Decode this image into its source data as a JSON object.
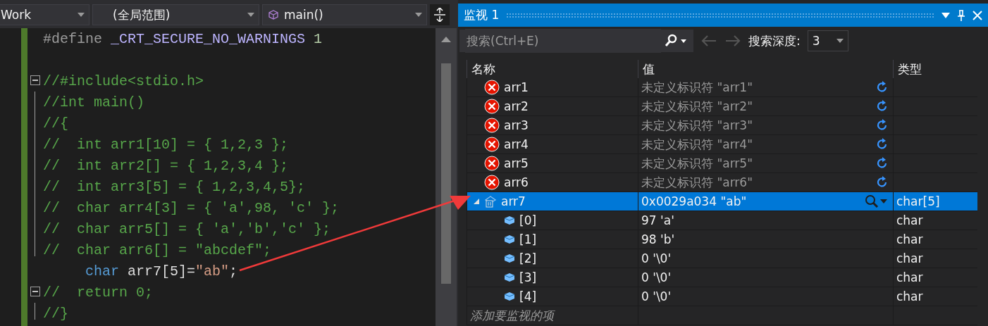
{
  "editor": {
    "dropdowns": [
      {
        "value": "Work",
        "kind": "plain"
      },
      {
        "value": "(全局范围)",
        "kind": "plain"
      },
      {
        "value": "main()",
        "kind": "function"
      }
    ],
    "lines": [
      {
        "fold": false,
        "tokens": [
          {
            "kind": "directive",
            "text": "#define "
          },
          {
            "kind": "macro",
            "text": "_CRT_SECURE_NO_WARNINGS "
          },
          {
            "kind": "number",
            "text": "1"
          }
        ]
      },
      {
        "fold": false
      },
      {
        "fold": true,
        "tokens": [
          {
            "kind": "comment",
            "text": "//#include<stdio.h>"
          }
        ]
      },
      {
        "fold": false,
        "tokens": [
          {
            "kind": "comment",
            "text": "//int main()"
          }
        ]
      },
      {
        "fold": false,
        "tokens": [
          {
            "kind": "comment",
            "text": "//{"
          }
        ]
      },
      {
        "fold": false,
        "tokens": [
          {
            "kind": "comment",
            "text": "//  int arr1[10] = { 1,2,3 };"
          }
        ]
      },
      {
        "fold": false,
        "tokens": [
          {
            "kind": "comment",
            "text": "//  int arr2[] = { 1,2,3,4 };"
          }
        ]
      },
      {
        "fold": false,
        "tokens": [
          {
            "kind": "comment",
            "text": "//  int arr3[5] = { 1,2,3,4,5};"
          }
        ]
      },
      {
        "fold": false,
        "tokens": [
          {
            "kind": "comment",
            "text": "//  char arr4[3] = { 'a',98, 'c' };"
          }
        ]
      },
      {
        "fold": false,
        "tokens": [
          {
            "kind": "comment",
            "text": "//  char arr5[] = { 'a','b','c' };"
          }
        ]
      },
      {
        "fold": false,
        "tokens": [
          {
            "kind": "comment",
            "text": "//  char arr6[] = \"abcdef\";"
          }
        ]
      },
      {
        "fold": false,
        "indent": true,
        "tokens": [
          {
            "kind": "keyword",
            "text": "char"
          },
          {
            "kind": "plain",
            "text": " arr7[5]="
          },
          {
            "kind": "string",
            "text": "\"ab\""
          },
          {
            "kind": "plain",
            "text": ";"
          }
        ]
      },
      {
        "fold": true,
        "tokens": [
          {
            "kind": "comment",
            "text": "//  return 0;"
          }
        ]
      },
      {
        "fold": false,
        "tokens": [
          {
            "kind": "comment",
            "text": "//}"
          }
        ]
      }
    ]
  },
  "watch": {
    "title": "监视 1",
    "search": {
      "placeholder": "搜索(Ctrl+E)"
    },
    "depth_label": "搜索深度:",
    "depth": "3",
    "columns": [
      "名称",
      "值",
      "类型"
    ],
    "rows": [
      {
        "kind": "error",
        "name": "arr1",
        "value": "未定义标识符 \"arr1\"",
        "selected": false
      },
      {
        "kind": "error",
        "name": "arr2",
        "value": "未定义标识符 \"arr2\"",
        "selected": false
      },
      {
        "kind": "error",
        "name": "arr3",
        "value": "未定义标识符 \"arr3\"",
        "selected": false
      },
      {
        "kind": "error",
        "name": "arr4",
        "value": "未定义标识符 \"arr4\"",
        "selected": false
      },
      {
        "kind": "error",
        "name": "arr5",
        "value": "未定义标识符 \"arr5\"",
        "selected": false
      },
      {
        "kind": "error",
        "name": "arr6",
        "value": "未定义标识符 \"arr6\"",
        "selected": false
      },
      {
        "kind": "array",
        "name": "arr7",
        "value": "0x0029a034 \"ab\"",
        "type": "char[5]",
        "selected": true,
        "expanded": true
      },
      {
        "kind": "element",
        "name": "[0]",
        "value": "97 'a'",
        "type": "char",
        "selected": false
      },
      {
        "kind": "element",
        "name": "[1]",
        "value": "98 'b'",
        "type": "char",
        "selected": false
      },
      {
        "kind": "element",
        "name": "[2]",
        "value": "0 '\\0'",
        "type": "char",
        "selected": false
      },
      {
        "kind": "element",
        "name": "[3]",
        "value": "0 '\\0'",
        "type": "char",
        "selected": false
      },
      {
        "kind": "element",
        "name": "[4]",
        "value": "0 '\\0'",
        "type": "char",
        "selected": false
      }
    ],
    "add_item": "添加要监视的项"
  }
}
